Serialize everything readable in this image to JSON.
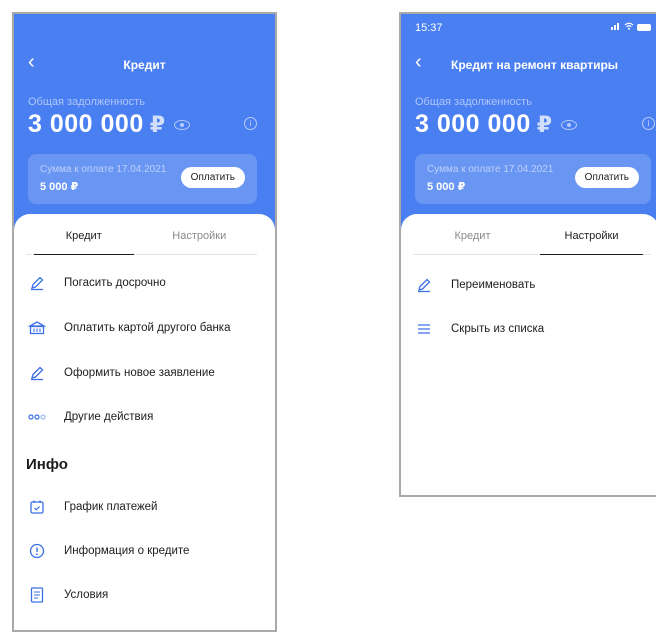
{
  "colors": {
    "accent": "#4a7ff1",
    "icon": "#3b6fe6"
  },
  "left": {
    "title": "Кредит",
    "debt_label": "Общая задолженность",
    "amount": "3 000 000",
    "currency": "₽",
    "payment": {
      "label": "Сумма к оплате 17.04.2021",
      "sum": "5 000 ₽",
      "button": "Оплатить"
    },
    "tabs": [
      "Кредит",
      "Настройки"
    ],
    "actions": [
      "Погасить досрочно",
      "Оплатить картой другого банка",
      "Оформить новое заявление",
      "Другие действия"
    ],
    "info_title": "Инфо",
    "info_items": [
      "График платежей",
      "Информация о кредите",
      "Условия"
    ]
  },
  "right": {
    "status_time": "15:37",
    "title": "Кредит на ремонт квартиры",
    "debt_label": "Общая задолженность",
    "amount": "3 000 000",
    "currency": "₽",
    "payment": {
      "label": "Сумма к оплате 17.04.2021",
      "sum": "5 000 ₽",
      "button": "Оплатить"
    },
    "tabs": [
      "Кредит",
      "Настройки"
    ],
    "actions": [
      "Переименовать",
      "Скрыть из списка"
    ]
  }
}
